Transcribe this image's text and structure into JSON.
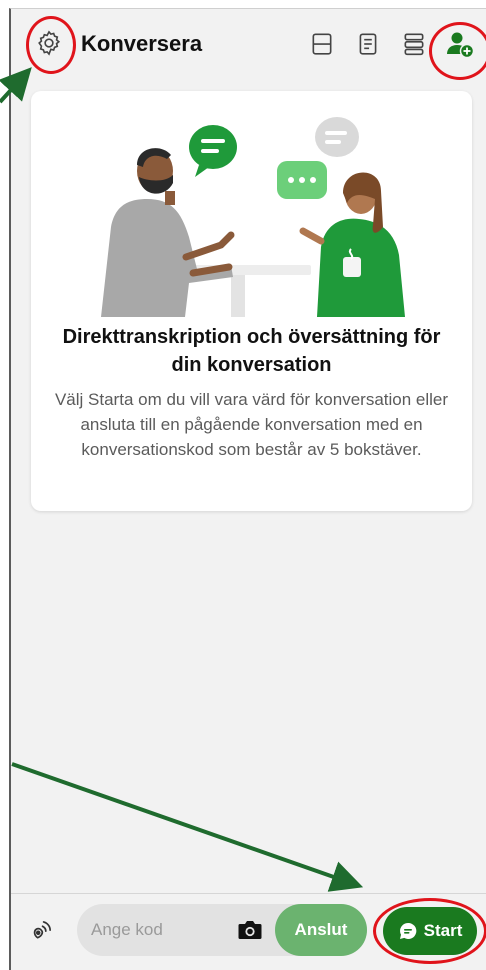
{
  "header": {
    "title": "Konversera",
    "icons": [
      "gear-icon",
      "split-layout-icon",
      "document-icon",
      "list-icon",
      "add-participant-icon"
    ]
  },
  "card": {
    "title": "Direkttranskription och översättning för din konversation",
    "body": "Välj Starta om du vill vara värd för konversation eller ansluta till en pågående konversation med en konversationskod som består av 5 bokstäver."
  },
  "bottom_bar": {
    "code_placeholder": "Ange kod",
    "join_label": "Anslut",
    "start_label": "Start"
  },
  "colors": {
    "brand_green": "#1a7a1f",
    "light_green": "#6bb36f",
    "highlight_red": "#e0141b",
    "arrow_green": "#1f6b2e"
  }
}
